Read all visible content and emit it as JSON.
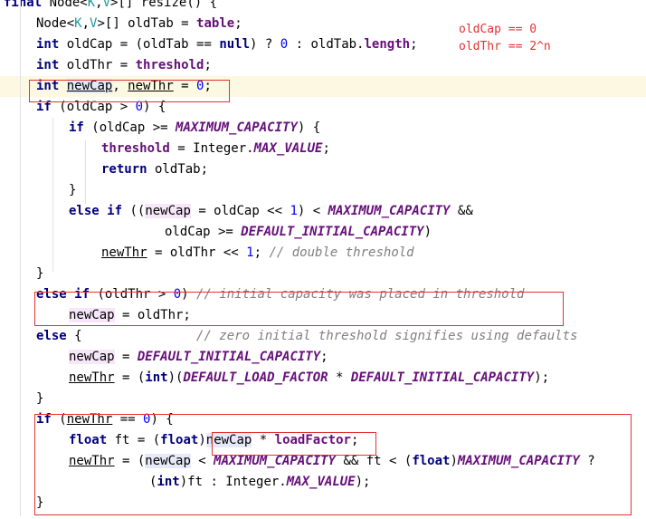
{
  "annotations": {
    "old_cap": "oldCap == 0",
    "old_thr": "oldThr == 2^n"
  },
  "lines": [
    {
      "indent": 0,
      "tokens": [
        [
          "kw",
          "final"
        ],
        [
          "plain",
          " Node<"
        ],
        [
          "gen",
          "K"
        ],
        [
          "plain",
          ","
        ],
        [
          "gen",
          "V"
        ],
        [
          "plain",
          ">[] resize() {"
        ]
      ]
    },
    {
      "indent": 1,
      "tokens": [
        [
          "plain",
          "Node<"
        ],
        [
          "gen",
          "K"
        ],
        [
          "plain",
          ","
        ],
        [
          "gen",
          "V"
        ],
        [
          "plain",
          ">[] oldTab = "
        ],
        [
          "fld",
          "table"
        ],
        [
          "plain",
          ";"
        ]
      ]
    },
    {
      "indent": 1,
      "tokens": [
        [
          "kw",
          "int"
        ],
        [
          "plain",
          " oldCap = (oldTab == "
        ],
        [
          "kw",
          "null"
        ],
        [
          "plain",
          ") ? "
        ],
        [
          "num",
          "0"
        ],
        [
          "plain",
          " : oldTab."
        ],
        [
          "fld",
          "length"
        ],
        [
          "plain",
          ";"
        ]
      ]
    },
    {
      "indent": 1,
      "tokens": [
        [
          "kw",
          "int"
        ],
        [
          "plain",
          " oldThr = "
        ],
        [
          "fld",
          "threshold"
        ],
        [
          "plain",
          ";"
        ]
      ]
    },
    {
      "indent": 1,
      "highlight": true,
      "tokens": [
        [
          "kw",
          "int"
        ],
        [
          "plain",
          " "
        ],
        [
          "u var-hl2",
          "newCap"
        ],
        [
          "plain",
          ", "
        ],
        [
          "u",
          "newThr"
        ],
        [
          "plain",
          " = "
        ],
        [
          "num",
          "0"
        ],
        [
          "plain",
          ";"
        ]
      ]
    },
    {
      "indent": 1,
      "tokens": [
        [
          "kw",
          "if"
        ],
        [
          "plain",
          " (oldCap > "
        ],
        [
          "num",
          "0"
        ],
        [
          "plain",
          ") {"
        ]
      ]
    },
    {
      "indent": 2,
      "tokens": [
        [
          "kw",
          "if"
        ],
        [
          "plain",
          " (oldCap >= "
        ],
        [
          "cst",
          "MAXIMUM_CAPACITY"
        ],
        [
          "plain",
          ") {"
        ]
      ]
    },
    {
      "indent": 3,
      "tokens": [
        [
          "fld",
          "threshold"
        ],
        [
          "plain",
          " = Integer."
        ],
        [
          "cst",
          "MAX_VALUE"
        ],
        [
          "plain",
          ";"
        ]
      ]
    },
    {
      "indent": 3,
      "tokens": [
        [
          "kw",
          "return"
        ],
        [
          "plain",
          " oldTab;"
        ]
      ]
    },
    {
      "indent": 2,
      "tokens": [
        [
          "plain",
          "}"
        ]
      ]
    },
    {
      "indent": 2,
      "tokens": [
        [
          "kw",
          "else if"
        ],
        [
          "plain",
          " (("
        ],
        [
          "var-hl",
          "newCap"
        ],
        [
          "plain",
          " = oldCap << "
        ],
        [
          "num",
          "1"
        ],
        [
          "plain",
          ") < "
        ],
        [
          "cst",
          "MAXIMUM_CAPACITY"
        ],
        [
          "plain",
          " &&"
        ]
      ]
    },
    {
      "indent": 4,
      "pad": 4,
      "tokens": [
        [
          "plain",
          "oldCap >= "
        ],
        [
          "cst",
          "DEFAULT_INITIAL_CAPACITY"
        ],
        [
          "plain",
          ")"
        ]
      ]
    },
    {
      "indent": 3,
      "tokens": [
        [
          "u",
          "newThr"
        ],
        [
          "plain",
          " = oldThr << "
        ],
        [
          "num",
          "1"
        ],
        [
          "plain",
          "; "
        ],
        [
          "cmt",
          "// double threshold"
        ]
      ]
    },
    {
      "indent": 1,
      "tokens": [
        [
          "plain",
          "}"
        ]
      ]
    },
    {
      "indent": 1,
      "tokens": [
        [
          "kw",
          "else if"
        ],
        [
          "plain",
          " (oldThr > "
        ],
        [
          "num",
          "0"
        ],
        [
          "plain",
          ") "
        ],
        [
          "cmt",
          "// initial capacity was placed in threshold"
        ]
      ]
    },
    {
      "indent": 2,
      "tokens": [
        [
          "var-hl",
          "newCap"
        ],
        [
          "plain",
          " = oldThr;"
        ]
      ]
    },
    {
      "indent": 1,
      "tokens": [
        [
          "kw",
          "else"
        ],
        [
          "plain",
          " {               "
        ],
        [
          "cmt",
          "// zero initial threshold signifies using defaults"
        ]
      ]
    },
    {
      "indent": 2,
      "tokens": [
        [
          "var-hl",
          "newCap"
        ],
        [
          "plain",
          " = "
        ],
        [
          "cst",
          "DEFAULT_INITIAL_CAPACITY"
        ],
        [
          "plain",
          ";"
        ]
      ]
    },
    {
      "indent": 2,
      "tokens": [
        [
          "u",
          "newThr"
        ],
        [
          "plain",
          " = ("
        ],
        [
          "kw",
          "int"
        ],
        [
          "plain",
          ")("
        ],
        [
          "cst",
          "DEFAULT_LOAD_FACTOR"
        ],
        [
          "plain",
          " * "
        ],
        [
          "cst",
          "DEFAULT_INITIAL_CAPACITY"
        ],
        [
          "plain",
          ");"
        ]
      ]
    },
    {
      "indent": 1,
      "tokens": [
        [
          "plain",
          "}"
        ]
      ]
    },
    {
      "indent": 1,
      "tokens": [
        [
          "kw",
          "if"
        ],
        [
          "plain",
          " ("
        ],
        [
          "u",
          "newThr"
        ],
        [
          "plain",
          " == "
        ],
        [
          "num",
          "0"
        ],
        [
          "plain",
          ") {"
        ]
      ]
    },
    {
      "indent": 2,
      "tokens": [
        [
          "kw",
          "float"
        ],
        [
          "plain",
          " ft = ("
        ],
        [
          "kw",
          "float"
        ],
        [
          "plain",
          ")"
        ],
        [
          "var-hl2",
          "newCap"
        ],
        [
          "plain",
          " * "
        ],
        [
          "fld",
          "loadFactor"
        ],
        [
          "plain",
          ";"
        ]
      ]
    },
    {
      "indent": 2,
      "tokens": [
        [
          "u",
          "newThr"
        ],
        [
          "plain",
          " = ("
        ],
        [
          "var-hl2",
          "newCap"
        ],
        [
          "plain",
          " < "
        ],
        [
          "cst",
          "MAXIMUM_CAPACITY"
        ],
        [
          "plain",
          " && ft < ("
        ],
        [
          "kw",
          "float"
        ],
        [
          "plain",
          ")"
        ],
        [
          "cst",
          "MAXIMUM_CAPACITY"
        ],
        [
          "plain",
          " ?"
        ]
      ]
    },
    {
      "indent": 4,
      "pad": 2,
      "tokens": [
        [
          "plain",
          "("
        ],
        [
          "kw",
          "int"
        ],
        [
          "plain",
          ")ft : Integer."
        ],
        [
          "cst",
          "MAX_VALUE"
        ],
        [
          "plain",
          ");"
        ]
      ]
    },
    {
      "indent": 1,
      "tokens": [
        [
          "plain",
          "}"
        ]
      ]
    }
  ]
}
